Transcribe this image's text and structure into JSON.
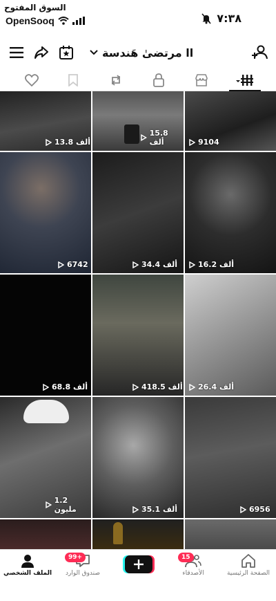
{
  "status_bar": {
    "watermark": "السوق المفتوح",
    "brand": "OpenSooq",
    "time": "٧:٣٨"
  },
  "header": {
    "username": "مرتضىٰ هَندسة ll"
  },
  "tabs": [
    {
      "name": "videos",
      "icon": "grid-icon"
    },
    {
      "name": "shop",
      "icon": "shop-icon"
    },
    {
      "name": "private",
      "icon": "lock-icon"
    },
    {
      "name": "reposts",
      "icon": "repost-icon"
    },
    {
      "name": "favorites",
      "icon": "bookmark-icon"
    },
    {
      "name": "liked",
      "icon": "heart-icon"
    }
  ],
  "videos": [
    {
      "views": "13.8 ألف"
    },
    {
      "views": "15.8 ألف"
    },
    {
      "views": "9104"
    },
    {
      "views": "6742"
    },
    {
      "views": "34.4 ألف"
    },
    {
      "views": "16.2 ألف"
    },
    {
      "views": "68.8 ألف"
    },
    {
      "views": "418.5 ألف"
    },
    {
      "views": "26.4 ألف"
    },
    {
      "views": "1.2 مليون"
    },
    {
      "views": "35.1 ألف"
    },
    {
      "views": "6956"
    }
  ],
  "bottom_nav": {
    "home": "الصفحة الرئيسية",
    "friends": "الأصدقاء",
    "friends_badge": "15",
    "inbox": "صندوق الوارد",
    "inbox_badge": "99+",
    "profile": "الملف الشخصي"
  },
  "colors": {
    "accent_red": "#fe2c55",
    "accent_cyan": "#25f4ee"
  }
}
